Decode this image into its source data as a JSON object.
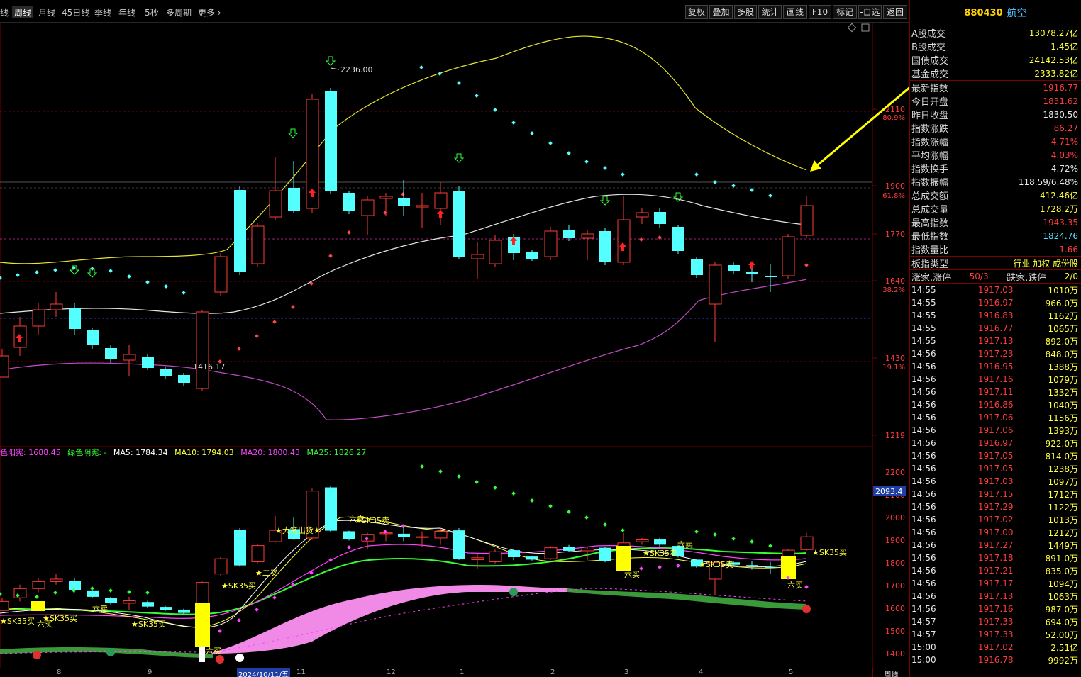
{
  "toolbar": {
    "periods": [
      "线",
      "周线",
      "月线",
      "45日线",
      "季线",
      "年线",
      "5秒",
      "多周期",
      "更多"
    ],
    "active_period": "周线",
    "tools": [
      "复权",
      "叠加",
      "多股",
      "统计",
      "画线",
      "F10",
      "标记",
      "-自选",
      "返回"
    ]
  },
  "main_chart": {
    "price_axis": [
      "2110",
      "1900",
      "1770",
      "1640",
      "1430",
      "1219"
    ],
    "pct_axis": [
      "80.9%",
      "61.8%",
      "38.2%",
      "19.1%"
    ],
    "high_label": "2236.00",
    "low_label": "1416.17"
  },
  "indicator_header": {
    "red_label": "色阳宪: 1688.45",
    "green_label": "绿色阴宪: -",
    "ma5": "MA5: 1784.34",
    "ma10": "MA10: 1794.03",
    "ma20": "MA20: 1800.43",
    "ma25": "MA25: 1826.27",
    "colors": {
      "red": "#ff44ff",
      "green": "#33ff33",
      "ma5": "#ffffff",
      "ma10": "#ffff3c",
      "ma20": "#ff44ff",
      "ma25": "#33ff33"
    }
  },
  "sub_chart": {
    "price_axis": [
      "2200",
      "2100",
      "2000",
      "1900",
      "1800",
      "1700",
      "1600",
      "1500",
      "1400"
    ],
    "current_value": "2093.4",
    "annotations": [
      "★SK35买",
      "六卖",
      "六买",
      "★SK35买",
      "★SK35买",
      "★SK35买",
      "★二叉",
      "★大笔出货★",
      "六卖",
      "★SK35卖",
      "六买",
      "★SK35卖",
      "六卖",
      "★SK35卖",
      "六买",
      "★SK35买",
      "六买"
    ]
  },
  "date_axis": {
    "ticks": [
      "8",
      "9",
      "11",
      "12",
      "1",
      "2",
      "3",
      "4",
      "5"
    ],
    "selected_date": "2024/10/11/五",
    "period": "周线"
  },
  "side_panel": {
    "code": "880430",
    "name": "航空",
    "turnover": [
      {
        "k": "A股成交",
        "v": "13078.27亿"
      },
      {
        "k": "B股成交",
        "v": "1.45亿"
      },
      {
        "k": "国债成交",
        "v": "24142.53亿"
      },
      {
        "k": "基金成交",
        "v": "2333.82亿"
      }
    ],
    "stats": [
      {
        "k": "最新指数",
        "v": "1916.77",
        "c": "red"
      },
      {
        "k": "今日开盘",
        "v": "1831.62",
        "c": "red"
      },
      {
        "k": "昨日收盘",
        "v": "1830.50",
        "c": "wht"
      },
      {
        "k": "指数涨跌",
        "v": "86.27",
        "c": "red"
      },
      {
        "k": "指数涨幅",
        "v": "4.71%",
        "c": "red"
      },
      {
        "k": "平均涨幅",
        "v": "4.03%",
        "c": "red"
      },
      {
        "k": "指数换手",
        "v": "4.72%",
        "c": "wht"
      },
      {
        "k": "指数振幅",
        "v": "118.59/6.48%",
        "c": "wht"
      },
      {
        "k": "总成交额",
        "v": "412.46亿",
        "c": "yel"
      },
      {
        "k": "总成交量",
        "v": "1728.2万",
        "c": "yel"
      },
      {
        "k": "最高指数",
        "v": "1943.35",
        "c": "red"
      },
      {
        "k": "最低指数",
        "v": "1824.76",
        "c": "cyn"
      },
      {
        "k": "指数量比",
        "v": "1.66",
        "c": "red"
      }
    ],
    "board_type_label": "板指类型",
    "board_type_value": "行业 加权 成份股",
    "up_down": {
      "up_label": "涨家.涨停",
      "up_value": "50/3",
      "down_label": "跌家.跌停",
      "down_value": "2/0"
    },
    "ticks": [
      {
        "t": "14:55",
        "p": "1917.03",
        "v": "1010万"
      },
      {
        "t": "14:55",
        "p": "1916.97",
        "v": "966.0万"
      },
      {
        "t": "14:55",
        "p": "1916.83",
        "v": "1162万"
      },
      {
        "t": "14:55",
        "p": "1916.77",
        "v": "1065万"
      },
      {
        "t": "14:55",
        "p": "1917.13",
        "v": "892.0万"
      },
      {
        "t": "14:56",
        "p": "1917.23",
        "v": "848.0万"
      },
      {
        "t": "14:56",
        "p": "1916.95",
        "v": "1388万"
      },
      {
        "t": "14:56",
        "p": "1917.16",
        "v": "1079万"
      },
      {
        "t": "14:56",
        "p": "1917.11",
        "v": "1332万"
      },
      {
        "t": "14:56",
        "p": "1916.86",
        "v": "1040万"
      },
      {
        "t": "14:56",
        "p": "1917.06",
        "v": "1156万"
      },
      {
        "t": "14:56",
        "p": "1917.06",
        "v": "1393万"
      },
      {
        "t": "14:56",
        "p": "1916.97",
        "v": "922.0万"
      },
      {
        "t": "14:56",
        "p": "1917.05",
        "v": "814.0万"
      },
      {
        "t": "14:56",
        "p": "1917.05",
        "v": "1238万"
      },
      {
        "t": "14:56",
        "p": "1917.03",
        "v": "1097万"
      },
      {
        "t": "14:56",
        "p": "1917.15",
        "v": "1712万"
      },
      {
        "t": "14:56",
        "p": "1917.29",
        "v": "1122万"
      },
      {
        "t": "14:56",
        "p": "1917.02",
        "v": "1013万"
      },
      {
        "t": "14:56",
        "p": "1917.00",
        "v": "1212万"
      },
      {
        "t": "14:56",
        "p": "1917.27",
        "v": "1449万"
      },
      {
        "t": "14:56",
        "p": "1917.18",
        "v": "891.0万"
      },
      {
        "t": "14:56",
        "p": "1917.21",
        "v": "835.0万"
      },
      {
        "t": "14:56",
        "p": "1917.17",
        "v": "1094万"
      },
      {
        "t": "14:56",
        "p": "1917.13",
        "v": "1063万"
      },
      {
        "t": "14:56",
        "p": "1917.16",
        "v": "987.0万"
      },
      {
        "t": "14:57",
        "p": "1917.33",
        "v": "694.0万"
      },
      {
        "t": "14:57",
        "p": "1917.33",
        "v": "52.00万"
      },
      {
        "t": "15:00",
        "p": "1917.02",
        "v": "2.51亿"
      },
      {
        "t": "15:00",
        "p": "1916.78",
        "v": "9992万"
      }
    ]
  },
  "colors": {
    "up": "#ff3b3b",
    "down": "#54ffff",
    "yellow": "#ffff3c",
    "magenta": "#ff44ff",
    "green": "#33ff33",
    "panel_border": "#7a0000"
  }
}
